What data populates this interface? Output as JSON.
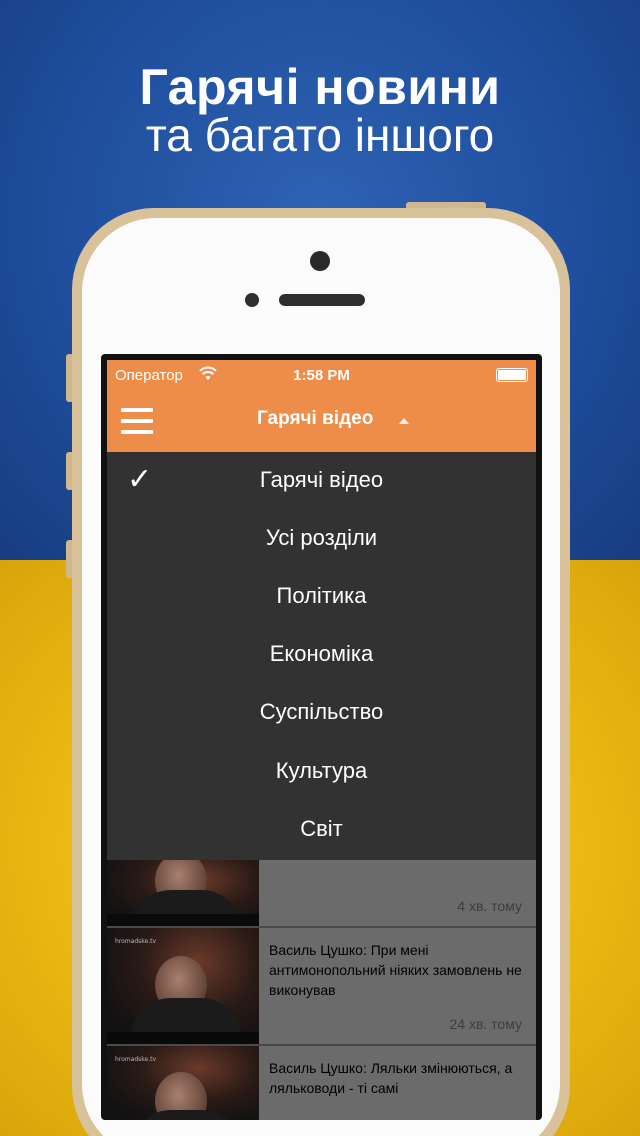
{
  "promo": {
    "headline": "Гарячі новини",
    "subheadline": "та багато іншого"
  },
  "status_bar": {
    "carrier": "Оператор",
    "time": "1:58 PM",
    "wifi_icon": "wifi-icon",
    "battery_icon": "battery-icon"
  },
  "nav": {
    "menu_icon": "hamburger-menu-icon",
    "title": "Гарячі відео",
    "toggle_icon": "chevron-up-icon"
  },
  "dropdown": {
    "selected_icon": "checkmark-icon",
    "check_glyph": "✓",
    "items": [
      {
        "label": "Гарячі відео",
        "selected": true
      },
      {
        "label": "Усі розділи",
        "selected": false
      },
      {
        "label": "Політика",
        "selected": false
      },
      {
        "label": "Економіка",
        "selected": false
      },
      {
        "label": "Суспільство",
        "selected": false
      },
      {
        "label": "Культура",
        "selected": false
      },
      {
        "label": "Світ",
        "selected": false
      }
    ]
  },
  "feed": [
    {
      "title": "",
      "time": "4 хв. тому"
    },
    {
      "title": "Василь Цушко: При мені антимонопольний ніяких замовлень не виконував",
      "time": "24 хв. тому"
    },
    {
      "title": "Василь Цушко: Ляльки змінюються, а ляльководи - ті самі",
      "time": ""
    }
  ],
  "colors": {
    "accent": "#ee8d49",
    "dropdown_bg": "#323232",
    "flag_blue": "#1f4f9e",
    "flag_yellow": "#f2c21a"
  }
}
